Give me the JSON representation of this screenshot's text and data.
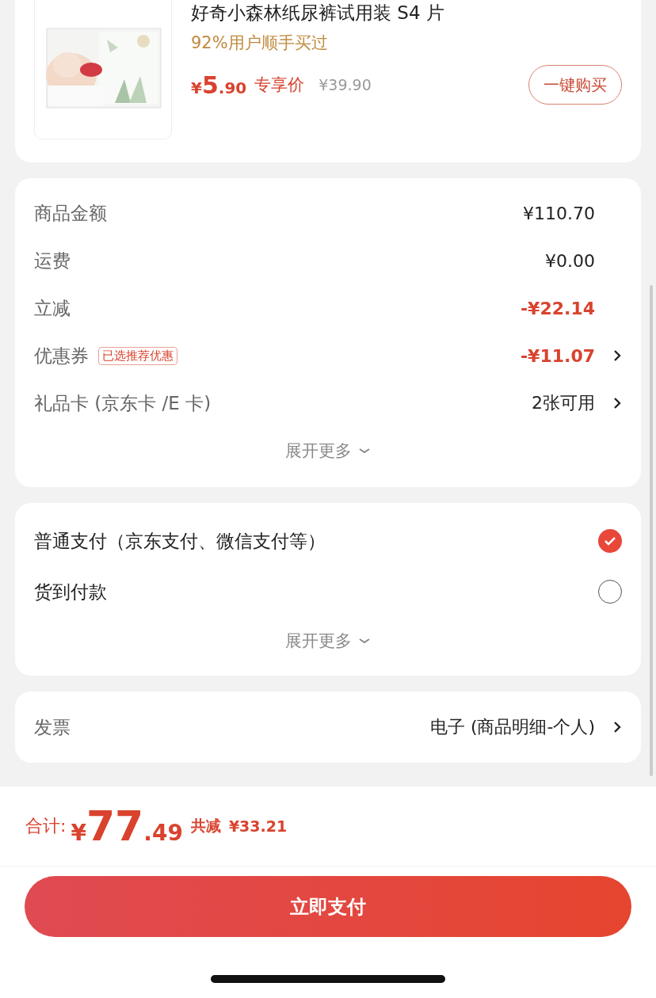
{
  "product": {
    "title": "好奇小森林纸尿裤试用装 S4 片",
    "bought": "92%用户顺手买过",
    "price_symbol": "¥",
    "price_int": "5",
    "price_dec": ".90",
    "price_tag": "专享价",
    "original_price": "¥39.90",
    "buy_button": "一键购买"
  },
  "fees": {
    "rows": [
      {
        "label": "商品金额",
        "value": "¥110.70",
        "kind": "plain",
        "arrow": false
      },
      {
        "label": "运费",
        "value": "¥0.00",
        "kind": "plain",
        "arrow": false
      },
      {
        "label": "立减",
        "value": "-¥22.14",
        "kind": "discount",
        "arrow": false
      },
      {
        "label": "优惠券",
        "badge": "已选推荐优惠",
        "value": "-¥11.07",
        "kind": "discount",
        "arrow": true
      },
      {
        "label": "礼品卡 (京东卡 /E 卡)",
        "value": "2张可用",
        "kind": "plain",
        "arrow": true
      }
    ],
    "expand": "展开更多"
  },
  "payment": {
    "options": [
      {
        "label": "普通支付（京东支付、微信支付等）",
        "selected": true
      },
      {
        "label": "货到付款",
        "selected": false
      }
    ],
    "expand": "展开更多"
  },
  "invoice": {
    "label": "发票",
    "value": "电子 (商品明细-个人)"
  },
  "footer": {
    "total_label": "合计:",
    "total_symbol": "¥",
    "total_int": "77",
    "total_dec": ".49",
    "saved_label": "共减",
    "saved_value": "¥33.21",
    "pay_button": "立即支付"
  }
}
